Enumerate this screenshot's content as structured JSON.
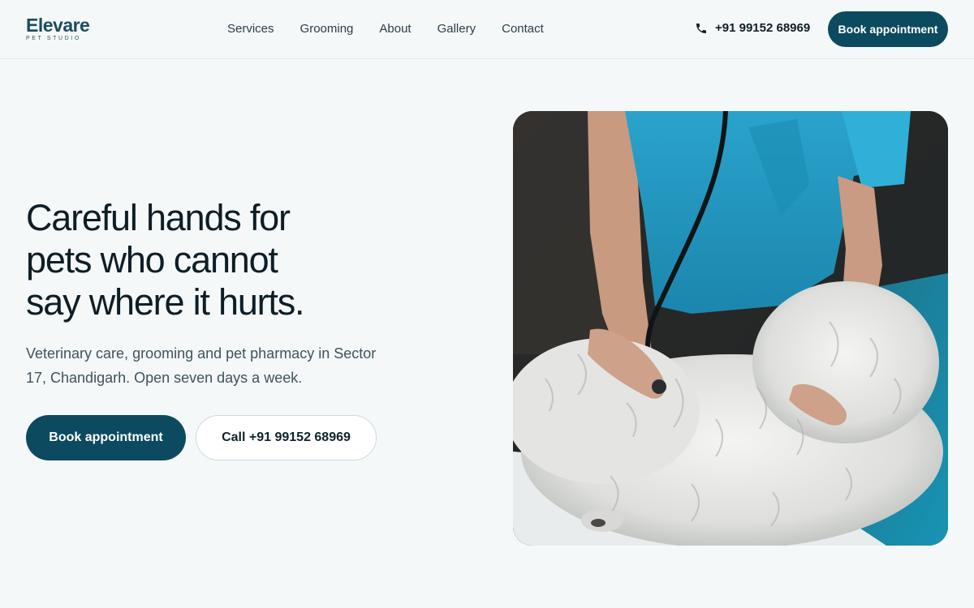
{
  "brand": {
    "name": "Elevare",
    "tagline": "PET STUDIO",
    "accent": "#0c4a5f"
  },
  "nav": {
    "items": [
      "Services",
      "Grooming",
      "About",
      "Gallery",
      "Contact"
    ]
  },
  "header": {
    "phone": "+91 99152 68969",
    "phone_icon": "phone-icon",
    "book_label": "Book appointment"
  },
  "hero": {
    "title_lines": [
      "Careful hands for",
      "pets who cannot",
      "say where it hurts."
    ],
    "subtitle": "Veterinary care, grooming and pet pharmacy in Sector 17, Chandigarh. Open seven days a week.",
    "book_label": "Book appointment",
    "call_label": "Call +91 99152 68969"
  }
}
